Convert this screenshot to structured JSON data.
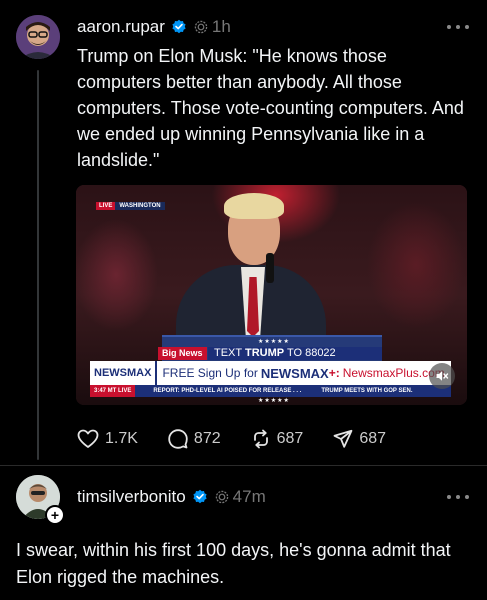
{
  "posts": [
    {
      "username": "aaron.rupar",
      "time": "1h",
      "text": "Trump on Elon Musk: \"He knows those computers better than anybody. All those computers. Those vote-counting computers. And we ended up winning Pennsylvania like in a landslide.\"",
      "media": {
        "live_label": "LIVE",
        "location_label": "WASHINGTON",
        "big_news_label": "Big News",
        "text_prefix": "TEXT ",
        "text_keyword": "TRUMP",
        "text_suffix": " TO 88022",
        "brand": "NEWSMAX",
        "promo_prefix": "FREE Sign Up for",
        "promo_brand": "NEWSMAX",
        "promo_plus": "+:",
        "promo_url": "NewsmaxPlus.com",
        "ticker_time": "3:47 MT  LIVE",
        "ticker_headline_1": "REPORT: PHD-LEVEL AI POISED FOR RELEASE . . .",
        "ticker_headline_2": "TRUMP MEETS WITH GOP SEN."
      },
      "likes": "1.7K",
      "replies": "872",
      "reposts": "687",
      "shares": "687"
    },
    {
      "username": "timsilverbonito",
      "time": "47m",
      "text": "I swear, within his first 100 days, he's gonna admit that Elon rigged the machines."
    }
  ],
  "colors": {
    "background": "#000000",
    "text": "#f3f5f7",
    "muted": "#777777",
    "verified": "#0095f6"
  },
  "icons": {
    "verified": "verified-badge-icon",
    "threads_ring": "threads-ring-icon",
    "more": "more-horizontal-icon",
    "like": "heart-icon",
    "reply": "comment-icon",
    "repost": "repost-icon",
    "share": "send-icon",
    "mute": "speaker-muted-icon",
    "follow": "plus-icon"
  }
}
